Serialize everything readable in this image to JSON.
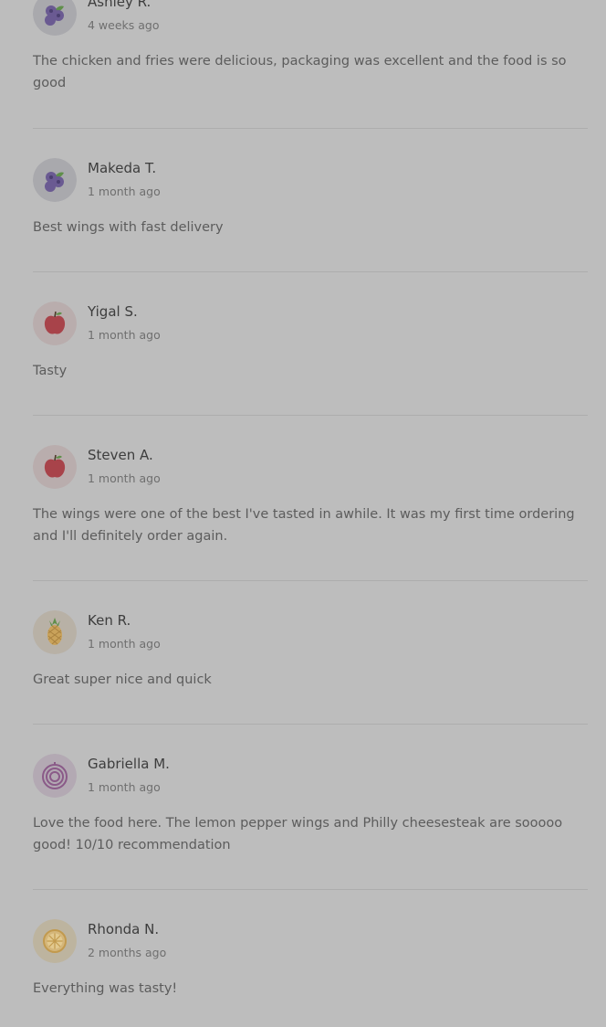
{
  "reviews": [
    {
      "name": "Ashley R.",
      "time": "4 weeks ago",
      "text": "The chicken and fries were delicious, packaging was excellent and the food is so good",
      "avatar_icon": "blueberry-icon"
    },
    {
      "name": "Makeda T.",
      "time": "1 month ago",
      "text": "Best wings with fast delivery",
      "avatar_icon": "blueberry-icon"
    },
    {
      "name": "Yigal S.",
      "time": "1 month ago",
      "text": "Tasty",
      "avatar_icon": "apple-icon"
    },
    {
      "name": "Steven A.",
      "time": "1 month ago",
      "text": "The wings were one of the best I've tasted in awhile. It was my first time ordering and I'll definitely order again.",
      "avatar_icon": "apple-icon"
    },
    {
      "name": "Ken R.",
      "time": "1 month ago",
      "text": "Great super nice and quick",
      "avatar_icon": "pineapple-icon"
    },
    {
      "name": "Gabriella M.",
      "time": "1 month ago",
      "text": "Love the food here. The lemon pepper wings and Philly cheesesteak are sooooo good! 10/10 recommendation",
      "avatar_icon": "onion-icon"
    },
    {
      "name": "Rhonda N.",
      "time": "2 months ago",
      "text": "Everything was tasty!",
      "avatar_icon": "citrus-icon"
    }
  ],
  "colors": {
    "overlay_bg": "#bdbdbd",
    "name": "#3d3d3d",
    "meta": "#6f6f6f",
    "body_text": "#5c5c5c",
    "divider": "#adadad"
  }
}
